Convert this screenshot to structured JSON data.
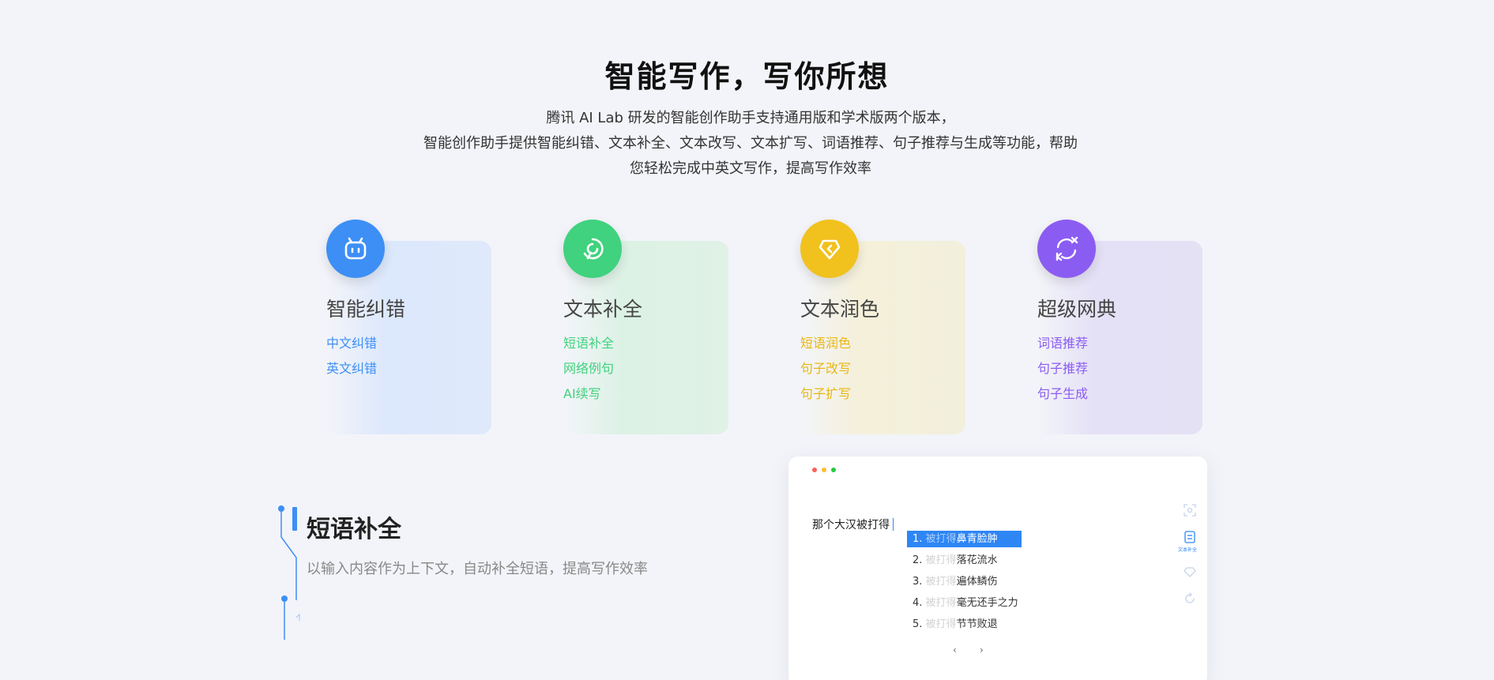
{
  "hero": {
    "title": "智能写作，写你所想",
    "desc_lines": [
      "腾讯 AI Lab 研发的智能创作助手支持通用版和学术版两个版本，",
      "智能创作助手提供智能纠错、文本补全、文本改写、文本扩写、词语推荐、句子推荐与生成等功能，帮助",
      "您轻松完成中英文写作，提高写作效率"
    ]
  },
  "features": [
    {
      "title": "智能纠错",
      "icon": "robot-face-icon",
      "color": "#3d8ff5",
      "links": [
        "中文纠错",
        "英文纠错"
      ]
    },
    {
      "title": "文本补全",
      "icon": "circular-text-icon",
      "color": "#40d27e",
      "links": [
        "短语补全",
        "网络例句",
        "AI续写"
      ]
    },
    {
      "title": "文本润色",
      "icon": "diamond-tag-icon",
      "color": "#f1c11d",
      "links": [
        "短语润色",
        "句子改写",
        "句子扩写"
      ]
    },
    {
      "title": "超级网典",
      "icon": "exchange-cycle-icon",
      "color": "#8b5cf2",
      "links": [
        "词语推荐",
        "句子推荐",
        "句子生成"
      ]
    }
  ],
  "section": {
    "title": "短语补全",
    "desc": "以输入内容作为上下文，自动补全短语，提高写作效率"
  },
  "demo": {
    "input_text": "那个大汉被打得",
    "suggestions": [
      {
        "index": "1.",
        "prefix": "被打得",
        "text": "鼻青脸肿"
      },
      {
        "index": "2.",
        "prefix": "被打得",
        "text": "落花流水"
      },
      {
        "index": "3.",
        "prefix": "被打得",
        "text": "遍体鳞伤"
      },
      {
        "index": "4.",
        "prefix": "被打得",
        "text": "毫无还手之力"
      },
      {
        "index": "5.",
        "prefix": "被打得",
        "text": "节节败退"
      }
    ],
    "pager_prev": "‹",
    "pager_next": "›",
    "side_tool_label": "文本补全",
    "colors": {
      "accent": "#2e86f5",
      "dot_red": "#ff5f57",
      "dot_yellow": "#febc2e",
      "dot_green": "#28c840"
    }
  }
}
